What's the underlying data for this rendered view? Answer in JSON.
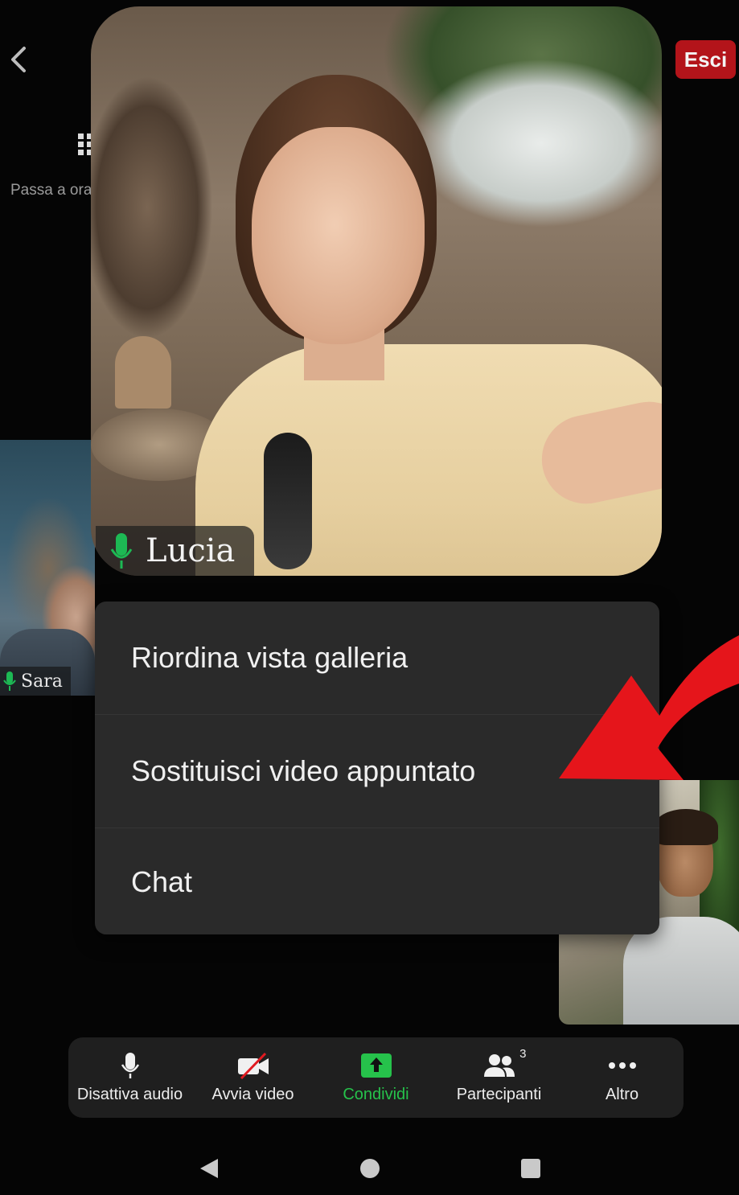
{
  "header": {
    "exit_label": "Esci",
    "switch_view_label": "Passa a ora"
  },
  "participants": {
    "pinned_name": "Lucia",
    "sara_name": "Sara"
  },
  "menu": {
    "items": [
      {
        "label": "Riordina vista galleria"
      },
      {
        "label": "Sostituisci video appuntato"
      },
      {
        "label": "Chat"
      }
    ]
  },
  "toolbar": {
    "mute_label": "Disattiva audio",
    "video_label": "Avvia video",
    "share_label": "Condividi",
    "participants_label": "Partecipanti",
    "participants_count": "3",
    "more_label": "Altro"
  },
  "colors": {
    "exit_bg": "#b3141a",
    "share_green": "#26c24b",
    "mic_green": "#1db954",
    "arrow_red": "#e5151b"
  },
  "icons": [
    "back-arrow-icon",
    "grid-icon",
    "mic-icon",
    "video-off-icon",
    "share-icon",
    "participants-icon",
    "more-icon"
  ]
}
